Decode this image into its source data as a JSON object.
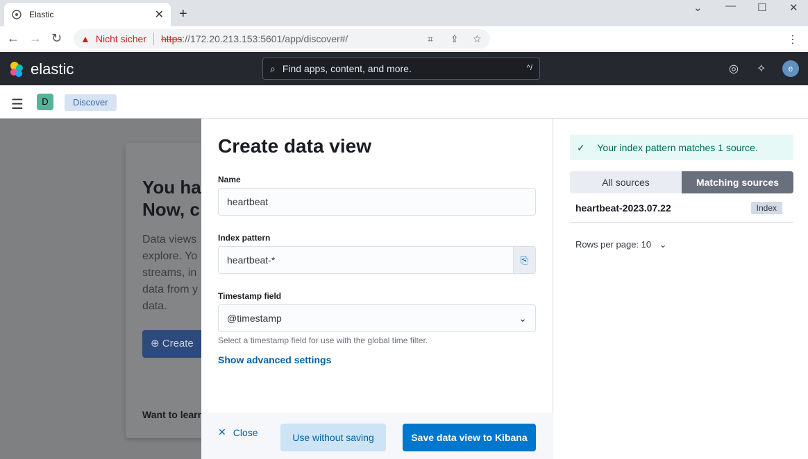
{
  "browser": {
    "tab_title": "Elastic",
    "tab_close": "✕",
    "new_tab": "+",
    "security_label": "Nicht sicher",
    "url_scheme": "https",
    "url_rest": "://172.20.213.153:5601/app/discover#/"
  },
  "kibana": {
    "brand": "elastic",
    "search_placeholder": "Find apps, content, and more.",
    "search_shortcut": "^/",
    "avatar_initial": "e",
    "space_initial": "D",
    "breadcrumb": "Discover"
  },
  "background": {
    "heading": "You have data in Elasticsearch. Now, create a data view.",
    "heading_line1": "You ha",
    "heading_line2": "Now, c",
    "body_lines": [
      "Data views",
      "explore. Yo",
      "streams, in",
      "data from y",
      "data."
    ],
    "button_label": "Create",
    "footer_text": "Want to learn"
  },
  "flyout": {
    "title": "Create data view",
    "name_label": "Name",
    "name_value": "heartbeat",
    "index_label": "Index pattern",
    "index_value": "heartbeat-*",
    "timestamp_label": "Timestamp field",
    "timestamp_value": "@timestamp",
    "timestamp_help": "Select a timestamp field for use with the global time filter.",
    "advanced_link": "Show advanced settings",
    "close_label": "Close",
    "use_without_saving": "Use without saving",
    "save_label": "Save data view to Kibana"
  },
  "sources": {
    "callout": "Your index pattern matches 1 source.",
    "tab_all": "All sources",
    "tab_matching": "Matching sources",
    "rows": [
      {
        "name": "heartbeat-2023.07.22",
        "type": "Index"
      }
    ],
    "rows_per_page": "Rows per page: 10"
  },
  "colors": {
    "primary": "#0077cc",
    "header": "#25282f",
    "success": "#006950"
  }
}
